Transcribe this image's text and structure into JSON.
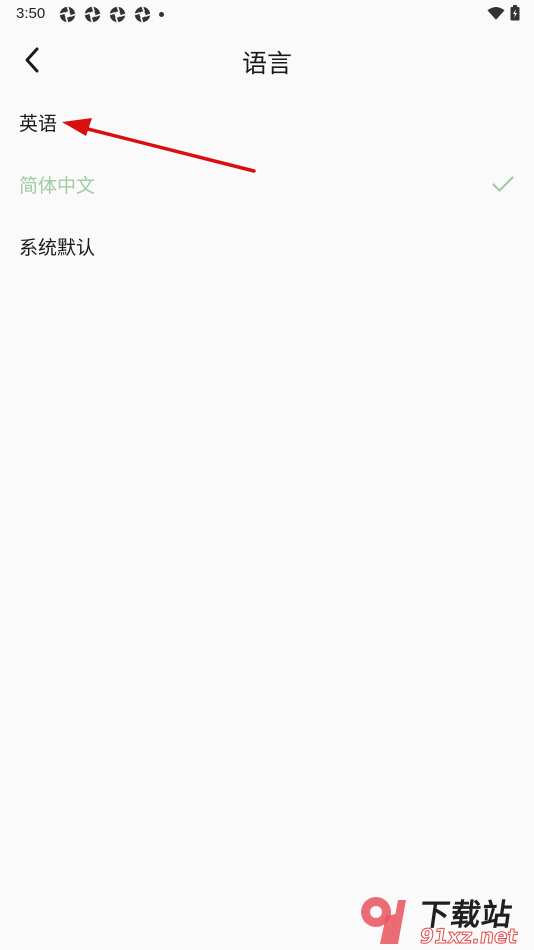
{
  "status_bar": {
    "time": "3:50",
    "notification_icons": [
      "aperture-icon",
      "aperture-icon",
      "aperture-icon",
      "aperture-icon"
    ],
    "right_icons": [
      "wifi-icon",
      "battery-charging-icon"
    ]
  },
  "app_bar": {
    "back_icon": "chevron-left-icon",
    "title": "语言"
  },
  "languages": [
    {
      "label": "英语",
      "selected": false
    },
    {
      "label": "简体中文",
      "selected": true
    },
    {
      "label": "系统默认",
      "selected": false
    }
  ],
  "annotation": {
    "type": "arrow",
    "color": "#d90f0f",
    "points_to": "英语"
  },
  "colors": {
    "background": "#fafafa",
    "selected_text": "#9fcca2",
    "check": "#9fcca2",
    "text": "#1a1a1a"
  },
  "watermark": {
    "title": "下载站",
    "url": "91xz.net",
    "logo_icon": "91-logo-icon"
  }
}
